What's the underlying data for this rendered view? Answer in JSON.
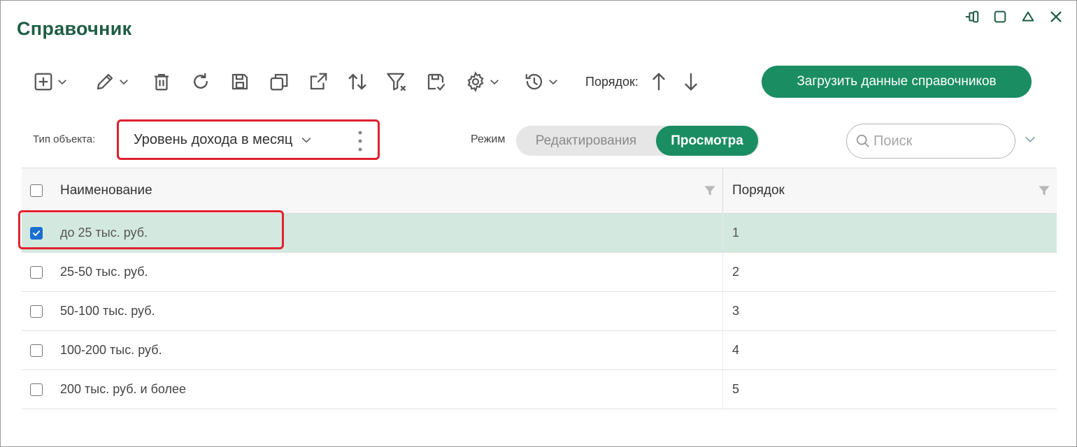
{
  "window": {
    "title": "Справочник"
  },
  "toolbar": {
    "order_label": "Порядок:",
    "load_button_label": "Загрузить данные справочников",
    "icons": [
      "add-icon",
      "edit-icon",
      "delete-icon",
      "refresh-icon",
      "save-icon",
      "copy-icon",
      "export-icon",
      "sort-icon",
      "clear-filter-icon",
      "save-check-icon",
      "settings-icon",
      "history-icon",
      "arrow-up-icon",
      "arrow-down-icon"
    ]
  },
  "object_type": {
    "label": "Тип объекта:",
    "value": "Уровень дохода в месяц"
  },
  "mode": {
    "label": "Режим",
    "options": [
      "Редактирования",
      "Просмотра"
    ],
    "selected": "Просмотра"
  },
  "search": {
    "placeholder": "Поиск"
  },
  "table": {
    "columns": [
      "Наименование",
      "Порядок"
    ],
    "rows": [
      {
        "name": "до 25 тыс. руб.",
        "order": "1",
        "checked": true
      },
      {
        "name": "25-50 тыс. руб.",
        "order": "2",
        "checked": false
      },
      {
        "name": "50-100 тыс. руб.",
        "order": "3",
        "checked": false
      },
      {
        "name": "100-200 тыс. руб.",
        "order": "4",
        "checked": false
      },
      {
        "name": "200 тыс. руб. и более",
        "order": "5",
        "checked": false
      }
    ]
  },
  "colors": {
    "accent": "#1a8d62",
    "title": "#1f5d44",
    "highlight_border": "#e0212f",
    "selected_row": "#d3e9e0",
    "checkbox_checked": "#1a6fd1"
  }
}
